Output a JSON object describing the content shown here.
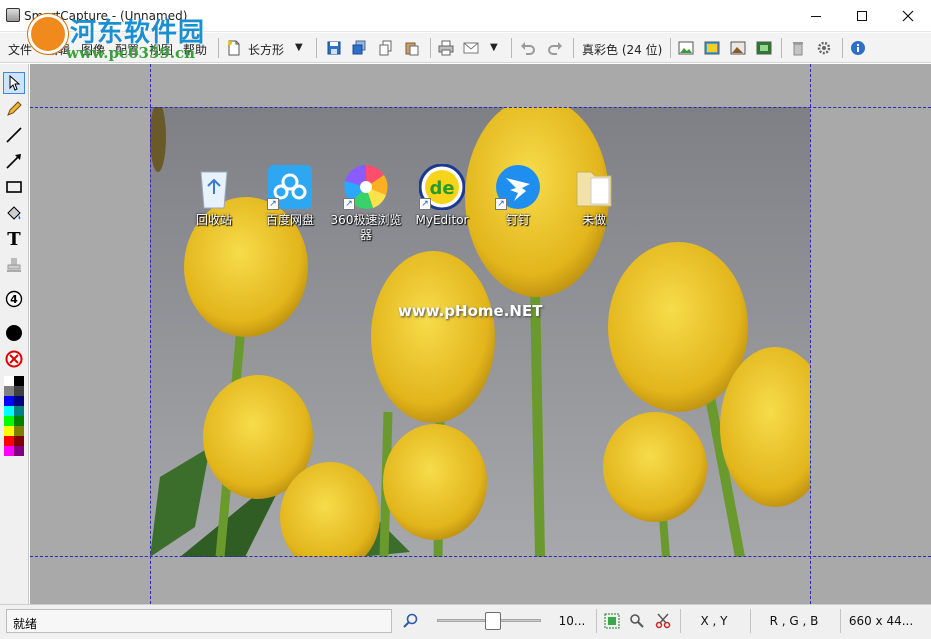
{
  "window": {
    "title": "SmartCapture - (Unnamed)",
    "controls": [
      "minimize",
      "maximize",
      "close"
    ]
  },
  "watermark": {
    "brand": "河东软件园",
    "url": "www.pc0359.cn"
  },
  "menu": {
    "items": [
      "文件",
      "编辑",
      "图像",
      "配置",
      "视图",
      "帮助"
    ]
  },
  "toolbar": {
    "capture_shape": "长方形",
    "color_depth": "真彩色 (24 位)"
  },
  "desktop_icons": [
    {
      "label": "回收站",
      "icon": "recycle-bin-icon"
    },
    {
      "label": "百度网盘",
      "icon": "baidu-netdisk-icon"
    },
    {
      "label": "360极速浏览器",
      "icon": "browser-360-icon"
    },
    {
      "label": "MyEditor",
      "icon": "myeditor-icon"
    },
    {
      "label": "钉钉",
      "icon": "dingtalk-icon"
    },
    {
      "label": "未做",
      "icon": "folder-icon"
    }
  ],
  "photo_watermark": "www.pHome.NET",
  "statusbar": {
    "status": "就绪",
    "zoom": "10...",
    "coords": "X , Y",
    "rgb": "R , G , B",
    "size": "660 x 44..."
  },
  "colors": {
    "selection_dash": "#2a2ab8",
    "canvas_bg": "#a9a9a9",
    "tulip_yellow": "#e9c320"
  },
  "palette_colors": [
    "#ffffff",
    "#000000",
    "#808080",
    "#404040",
    "#0000ff",
    "#000080",
    "#00ffff",
    "#008080",
    "#00ff00",
    "#008000",
    "#ffff00",
    "#808000",
    "#ff0000",
    "#800000",
    "#ff00ff",
    "#800080"
  ]
}
